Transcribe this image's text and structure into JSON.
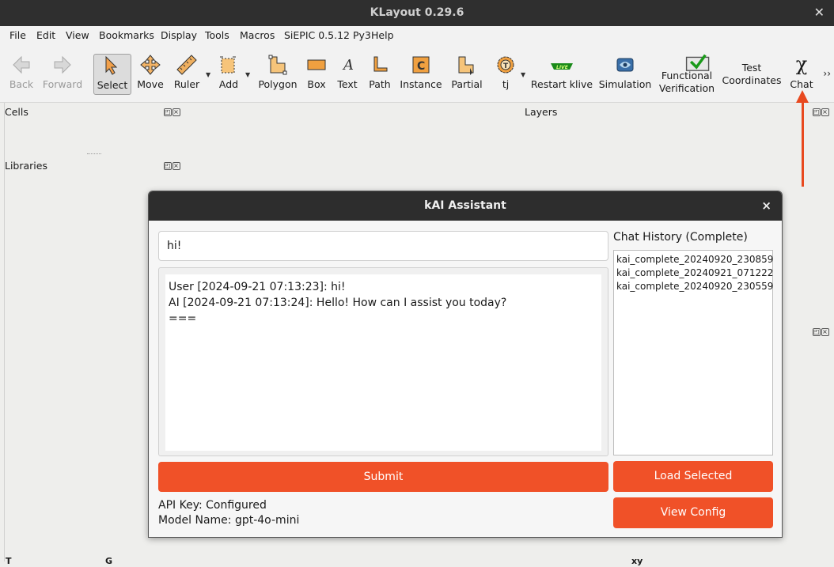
{
  "window": {
    "title": "KLayout 0.29.6",
    "close": "✕"
  },
  "menu": [
    "File",
    "Edit",
    "View",
    "Bookmarks",
    "Display",
    "Tools",
    "Macros",
    "SiEPIC 0.5.12 Py3",
    "Help"
  ],
  "toolbar": {
    "back": "Back",
    "forward": "Forward",
    "select": "Select",
    "move": "Move",
    "ruler": "Ruler",
    "add": "Add",
    "polygon": "Polygon",
    "box": "Box",
    "text": "Text",
    "path": "Path",
    "instance": "Instance",
    "partial": "Partial",
    "tj": "tj",
    "restart_klive": "Restart klive",
    "simulation": "Simulation",
    "functional_verification_1": "Functional",
    "functional_verification_2": "Verification",
    "test_coordinates_1": "Test",
    "test_coordinates_2": "Coordinates",
    "chat": "Chat",
    "chat_glyph": "χ",
    "more": "››",
    "live_badge": "LIVE"
  },
  "docks": {
    "cells": "Cells",
    "libraries": "Libraries",
    "layers": "Layers"
  },
  "status": {
    "t": "T",
    "g": "G",
    "xy": "xy"
  },
  "dialog": {
    "title": "kAI Assistant",
    "close": "×",
    "input_value": "hi!",
    "chat_lines": [
      "User [2024-09-21 07:13:23]: hi!",
      "AI [2024-09-21 07:13:24]: Hello! How can I assist you today?",
      "==="
    ],
    "history_label": "Chat History (Complete)",
    "history_items": [
      "kai_complete_20240920_230859",
      "kai_complete_20240921_071222",
      "kai_complete_20240920_230559"
    ],
    "submit": "Submit",
    "load_selected": "Load Selected",
    "view_config": "View Config",
    "api_key": "API Key: Configured",
    "model_name": "Model Name: gpt-4o-mini"
  },
  "colors": {
    "accent": "#f05128",
    "arrow": "#e8491f",
    "titlebar": "#2f2f2f"
  }
}
